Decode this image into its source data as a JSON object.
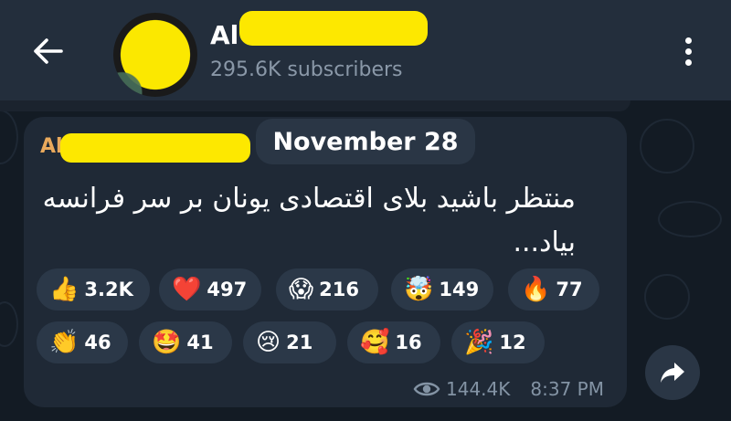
{
  "header": {
    "channel_name": "Al",
    "subscribers": "295.6K subscribers"
  },
  "message": {
    "sender": "Al",
    "date": "November 28",
    "text": "منتظر باشید بلای اقتصادی یونان بر سر فرانسه بیاد...",
    "reactions": [
      {
        "emoji": "👍",
        "count": "3.2K"
      },
      {
        "emoji": "❤️",
        "count": "497"
      },
      {
        "emoji": "😱",
        "count": "216"
      },
      {
        "emoji": "🤯",
        "count": "149"
      },
      {
        "emoji": "🔥",
        "count": "77"
      },
      {
        "emoji": "👏",
        "count": "46"
      },
      {
        "emoji": "🤩",
        "count": "41"
      },
      {
        "emoji": "😢",
        "count": "21"
      },
      {
        "emoji": "🥰",
        "count": "16"
      },
      {
        "emoji": "🎉",
        "count": "12"
      }
    ],
    "views": "144.4K",
    "time": "8:37 PM"
  },
  "icons": {
    "back": "arrow-left-icon",
    "menu": "more-vertical-icon",
    "views": "eye-icon",
    "forward": "share-arrow-icon"
  },
  "colors": {
    "background": "#131b24",
    "header": "#232e3c",
    "bubble": "#1f2936",
    "reaction_pill": "#2b3848",
    "sender_name": "#e9a95c",
    "redaction": "#fde800"
  }
}
